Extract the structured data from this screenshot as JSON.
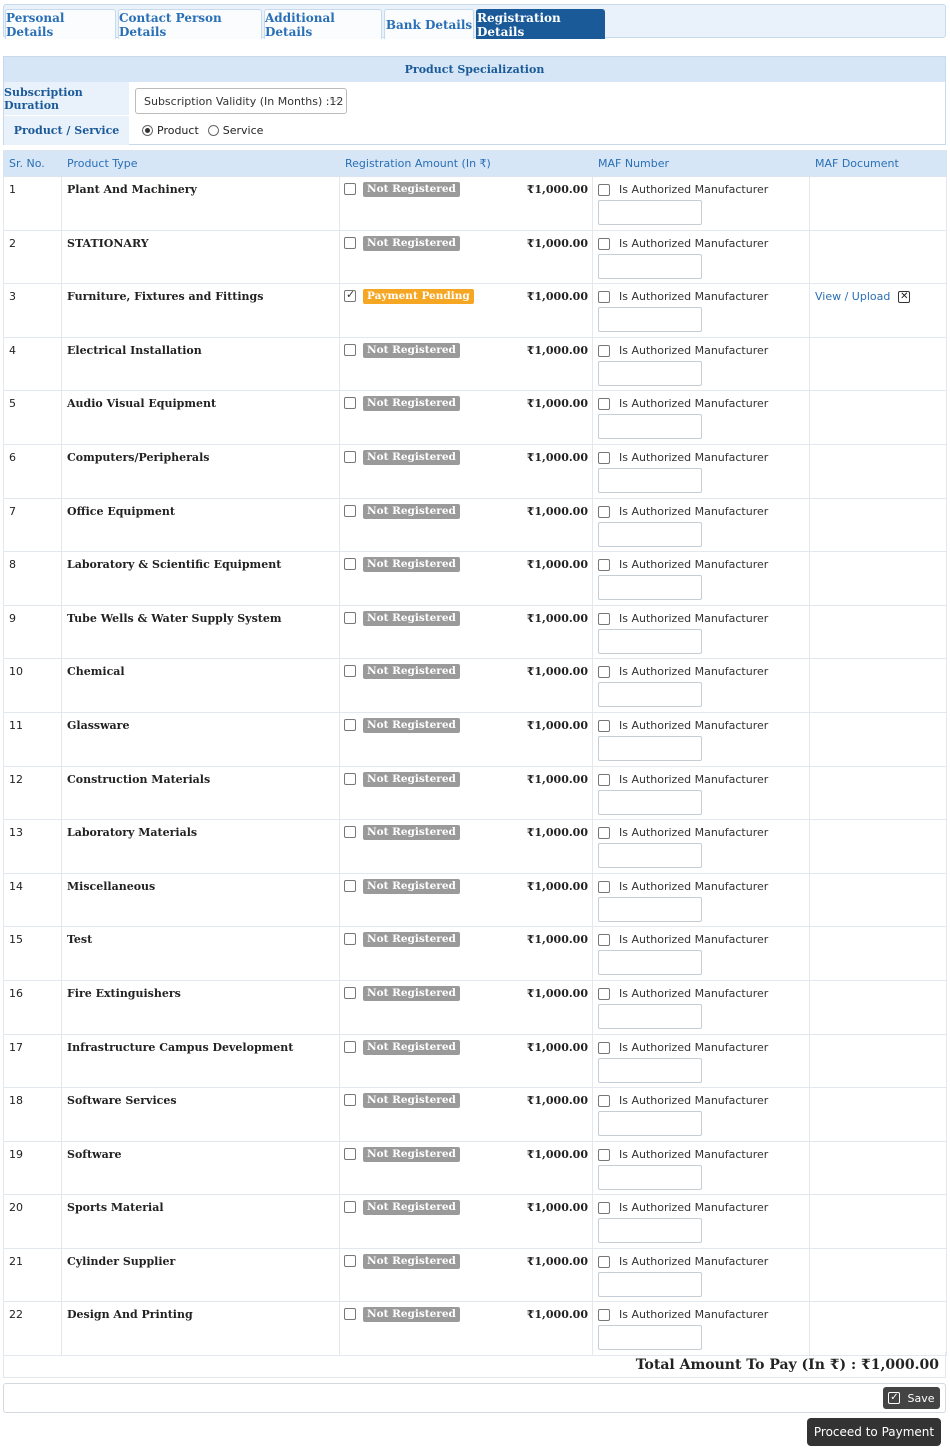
{
  "tabs": [
    {
      "label": "Personal Details"
    },
    {
      "label": "Contact Person Details"
    },
    {
      "label": "Additional Details"
    },
    {
      "label": "Bank Details"
    },
    {
      "label": "Registration Details"
    }
  ],
  "spec": {
    "title": "Product Specialization",
    "subscription_label": "Subscription Duration",
    "subscription_value": "Subscription Validity (In Months) :12",
    "product_service_label": "Product / Service",
    "product_option": "Product",
    "service_option": "Service",
    "selected": "Product"
  },
  "table": {
    "headers": [
      "Sr. No.",
      "Product Type",
      "Registration Amount (In ₹)",
      "MAF Number",
      "MAF Document"
    ],
    "maf_label": "Is Authorized Manufacturer",
    "doc_link": "View / Upload",
    "rows": [
      {
        "sr": "1",
        "type": "Plant And Machinery",
        "status": "Not Registered",
        "checked": false,
        "amount": "₹1,000.00"
      },
      {
        "sr": "2",
        "type": "STATIONARY",
        "status": "Not Registered",
        "checked": false,
        "amount": "₹1,000.00"
      },
      {
        "sr": "3",
        "type": "Furniture, Fixtures and Fittings",
        "status": "Payment Pending",
        "checked": true,
        "amount": "₹1,000.00",
        "has_doc": true
      },
      {
        "sr": "4",
        "type": "Electrical Installation",
        "status": "Not Registered",
        "checked": false,
        "amount": "₹1,000.00"
      },
      {
        "sr": "5",
        "type": "Audio Visual Equipment",
        "status": "Not Registered",
        "checked": false,
        "amount": "₹1,000.00"
      },
      {
        "sr": "6",
        "type": "Computers/Peripherals",
        "status": "Not Registered",
        "checked": false,
        "amount": "₹1,000.00"
      },
      {
        "sr": "7",
        "type": "Office Equipment",
        "status": "Not Registered",
        "checked": false,
        "amount": "₹1,000.00"
      },
      {
        "sr": "8",
        "type": "Laboratory & Scientific Equipment",
        "status": "Not Registered",
        "checked": false,
        "amount": "₹1,000.00"
      },
      {
        "sr": "9",
        "type": "Tube Wells & Water Supply System",
        "status": "Not Registered",
        "checked": false,
        "amount": "₹1,000.00"
      },
      {
        "sr": "10",
        "type": "Chemical",
        "status": "Not Registered",
        "checked": false,
        "amount": "₹1,000.00"
      },
      {
        "sr": "11",
        "type": "Glassware",
        "status": "Not Registered",
        "checked": false,
        "amount": "₹1,000.00"
      },
      {
        "sr": "12",
        "type": "Construction Materials",
        "status": "Not Registered",
        "checked": false,
        "amount": "₹1,000.00"
      },
      {
        "sr": "13",
        "type": "Laboratory Materials",
        "status": "Not Registered",
        "checked": false,
        "amount": "₹1,000.00"
      },
      {
        "sr": "14",
        "type": "Miscellaneous",
        "status": "Not Registered",
        "checked": false,
        "amount": "₹1,000.00"
      },
      {
        "sr": "15",
        "type": "Test",
        "status": "Not Registered",
        "checked": false,
        "amount": "₹1,000.00"
      },
      {
        "sr": "16",
        "type": "Fire Extinguishers",
        "status": "Not Registered",
        "checked": false,
        "amount": "₹1,000.00"
      },
      {
        "sr": "17",
        "type": "Infrastructure Campus Development",
        "status": "Not Registered",
        "checked": false,
        "amount": "₹1,000.00"
      },
      {
        "sr": "18",
        "type": "Software Services",
        "status": "Not Registered",
        "checked": false,
        "amount": "₹1,000.00"
      },
      {
        "sr": "19",
        "type": "Software",
        "status": "Not Registered",
        "checked": false,
        "amount": "₹1,000.00"
      },
      {
        "sr": "20",
        "type": "Sports Material",
        "status": "Not Registered",
        "checked": false,
        "amount": "₹1,000.00"
      },
      {
        "sr": "21",
        "type": "Cylinder Supplier",
        "status": "Not Registered",
        "checked": false,
        "amount": "₹1,000.00"
      },
      {
        "sr": "22",
        "type": "Design And Printing",
        "status": "Not Registered",
        "checked": false,
        "amount": "₹1,000.00"
      }
    ]
  },
  "total": {
    "text": "Total Amount To Pay (In ₹)  :  ₹1,000.00"
  },
  "buttons": {
    "save": "Save",
    "proceed": "Proceed to Payment"
  },
  "colors": {
    "accent": "#1a5a98",
    "header_bg": "#d6e6f6",
    "badge_gray": "#9a9a9a",
    "badge_orange": "#f5a623"
  }
}
